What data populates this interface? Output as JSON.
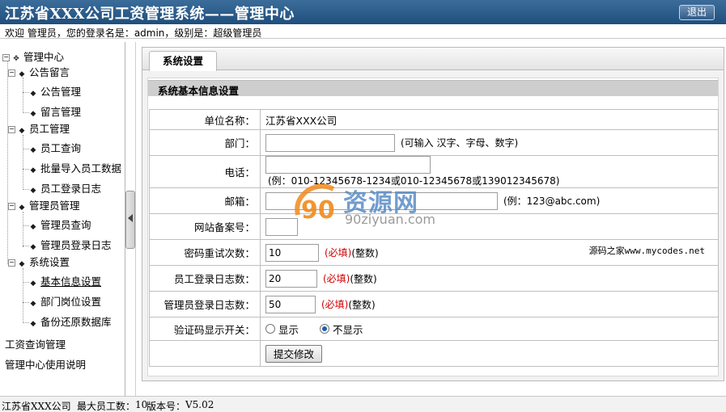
{
  "header": {
    "title": "江苏省XXX公司工资管理系统——管理中心",
    "logout_label": "退出"
  },
  "welcome": {
    "text": "欢迎 管理员，您的登录名是：admin，级别是：超级管理员"
  },
  "sidebar": {
    "root": "管理中心",
    "groups": [
      {
        "label": "公告留言",
        "items": [
          "公告管理",
          "留言管理"
        ]
      },
      {
        "label": "员工管理",
        "items": [
          "员工查询",
          "批量导入员工数据",
          "员工登录日志"
        ]
      },
      {
        "label": "管理员管理",
        "items": [
          "管理员查询",
          "管理员登录日志"
        ]
      },
      {
        "label": "系统设置",
        "items": [
          "基本信息设置",
          "部门岗位设置",
          "备份还原数据库"
        ]
      }
    ],
    "active_item": "基本信息设置",
    "links": [
      "工资查询管理",
      "管理中心使用说明"
    ]
  },
  "tabs": [
    {
      "label": "系统设置",
      "active": true
    }
  ],
  "section_title": "系统基本信息设置",
  "form": {
    "unit": {
      "label": "单位名称：",
      "value": "江苏省XXX公司"
    },
    "department": {
      "label": "部门：",
      "value": "",
      "hint": "(可输入 汉字、字母、数字)"
    },
    "phone": {
      "label": "电话：",
      "value": "",
      "hint": "(例：010-12345678-1234或010-12345678或139012345678)"
    },
    "email": {
      "label": "邮箱：",
      "value": "",
      "hint": "(例：123@abc.com)"
    },
    "icp": {
      "label": "网站备案号：",
      "value": ""
    },
    "password_retry": {
      "label": "密码重试次数：",
      "value": "10",
      "required": "(必填)",
      "unit": "(整数)",
      "note": "源码之家www.mycodes.net"
    },
    "staff_log": {
      "label": "员工登录日志数：",
      "value": "20",
      "required": "(必填)",
      "unit": "(整数)"
    },
    "admin_log": {
      "label": "管理员登录日志数：",
      "value": "50",
      "required": "(必填)",
      "unit": "(整数)"
    },
    "captcha": {
      "label": "验证码显示开关：",
      "options": [
        "显示",
        "不显示"
      ],
      "selected": "不显示"
    },
    "submit_label": "提交修改"
  },
  "watermark": {
    "text_cn": "资源网",
    "text_en": "90ziyuan.com",
    "mark": "90"
  },
  "status": {
    "company": "江苏省XXX公司",
    "max_staff_label": "最大员工数：",
    "max_staff": "10",
    "version_label": "版本号：",
    "version": "V5.02"
  },
  "colors": {
    "title_bar": "#2a5b8a",
    "required": "#d00000",
    "section_head": "#cecece",
    "watermark_blue": "#5b8cc6",
    "watermark_orange": "#f08a1c"
  }
}
